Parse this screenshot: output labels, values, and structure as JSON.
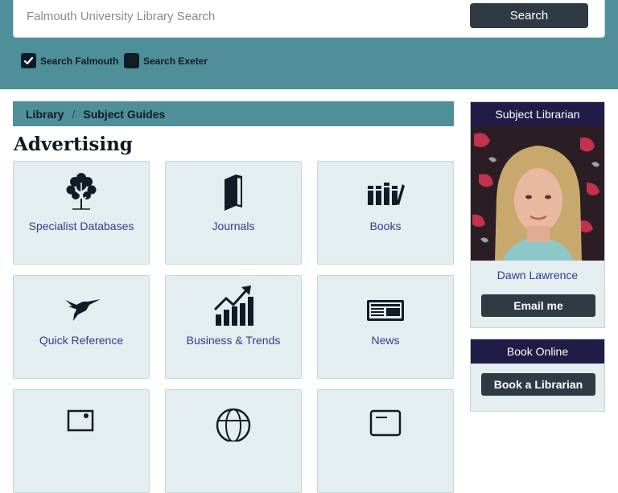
{
  "search": {
    "placeholder": "Falmouth University Library Search",
    "button_label": "Search",
    "options": [
      {
        "label": "Search Falmouth",
        "checked": true
      },
      {
        "label": "Search Exeter",
        "checked": false
      }
    ]
  },
  "breadcrumb": {
    "items": [
      "Library",
      "Subject Guides"
    ],
    "separator": "/"
  },
  "page": {
    "title": "Advertising"
  },
  "tiles": [
    {
      "label": "Specialist Databases",
      "icon": "tree-icon"
    },
    {
      "label": "Journals",
      "icon": "journal-icon"
    },
    {
      "label": "Books",
      "icon": "books-icon"
    },
    {
      "label": "Quick Reference",
      "icon": "hummingbird-icon"
    },
    {
      "label": "Business & Trends",
      "icon": "trend-chart-icon"
    },
    {
      "label": "News",
      "icon": "newspaper-icon"
    },
    {
      "label": "",
      "icon": "image-icon"
    },
    {
      "label": "",
      "icon": "globe-icon"
    },
    {
      "label": "",
      "icon": "card-icon"
    }
  ],
  "sidebar": {
    "librarian": {
      "heading": "Subject Librarian",
      "name": "Dawn Lawrence",
      "button_label": "Email me"
    },
    "booking": {
      "heading": "Book Online",
      "button_label": "Book a Librarian"
    }
  },
  "colors": {
    "band": "#4f8f99",
    "tile_bg": "#e4edf0",
    "link": "#2e3f8f",
    "dark_button": "#2f3a43",
    "sidebar_head": "#1f1c46"
  }
}
